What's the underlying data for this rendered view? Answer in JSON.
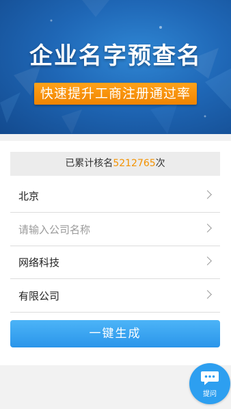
{
  "banner": {
    "title": "企业名字预查名",
    "subtitle": "快速提升工商注册通过率"
  },
  "counter": {
    "prefix": "已累计核名",
    "number": "5212765",
    "suffix": "次"
  },
  "form": {
    "city": "北京",
    "company_placeholder": "请输入公司名称",
    "industry": "网络科技",
    "company_type": "有限公司"
  },
  "actions": {
    "generate_label": "一键生成",
    "ask_label": "提问"
  },
  "colors": {
    "accent_orange": "#f39200",
    "button_blue": "#2d9ff0"
  },
  "icons": [
    "chevron-right-icon",
    "chat-icon"
  ]
}
